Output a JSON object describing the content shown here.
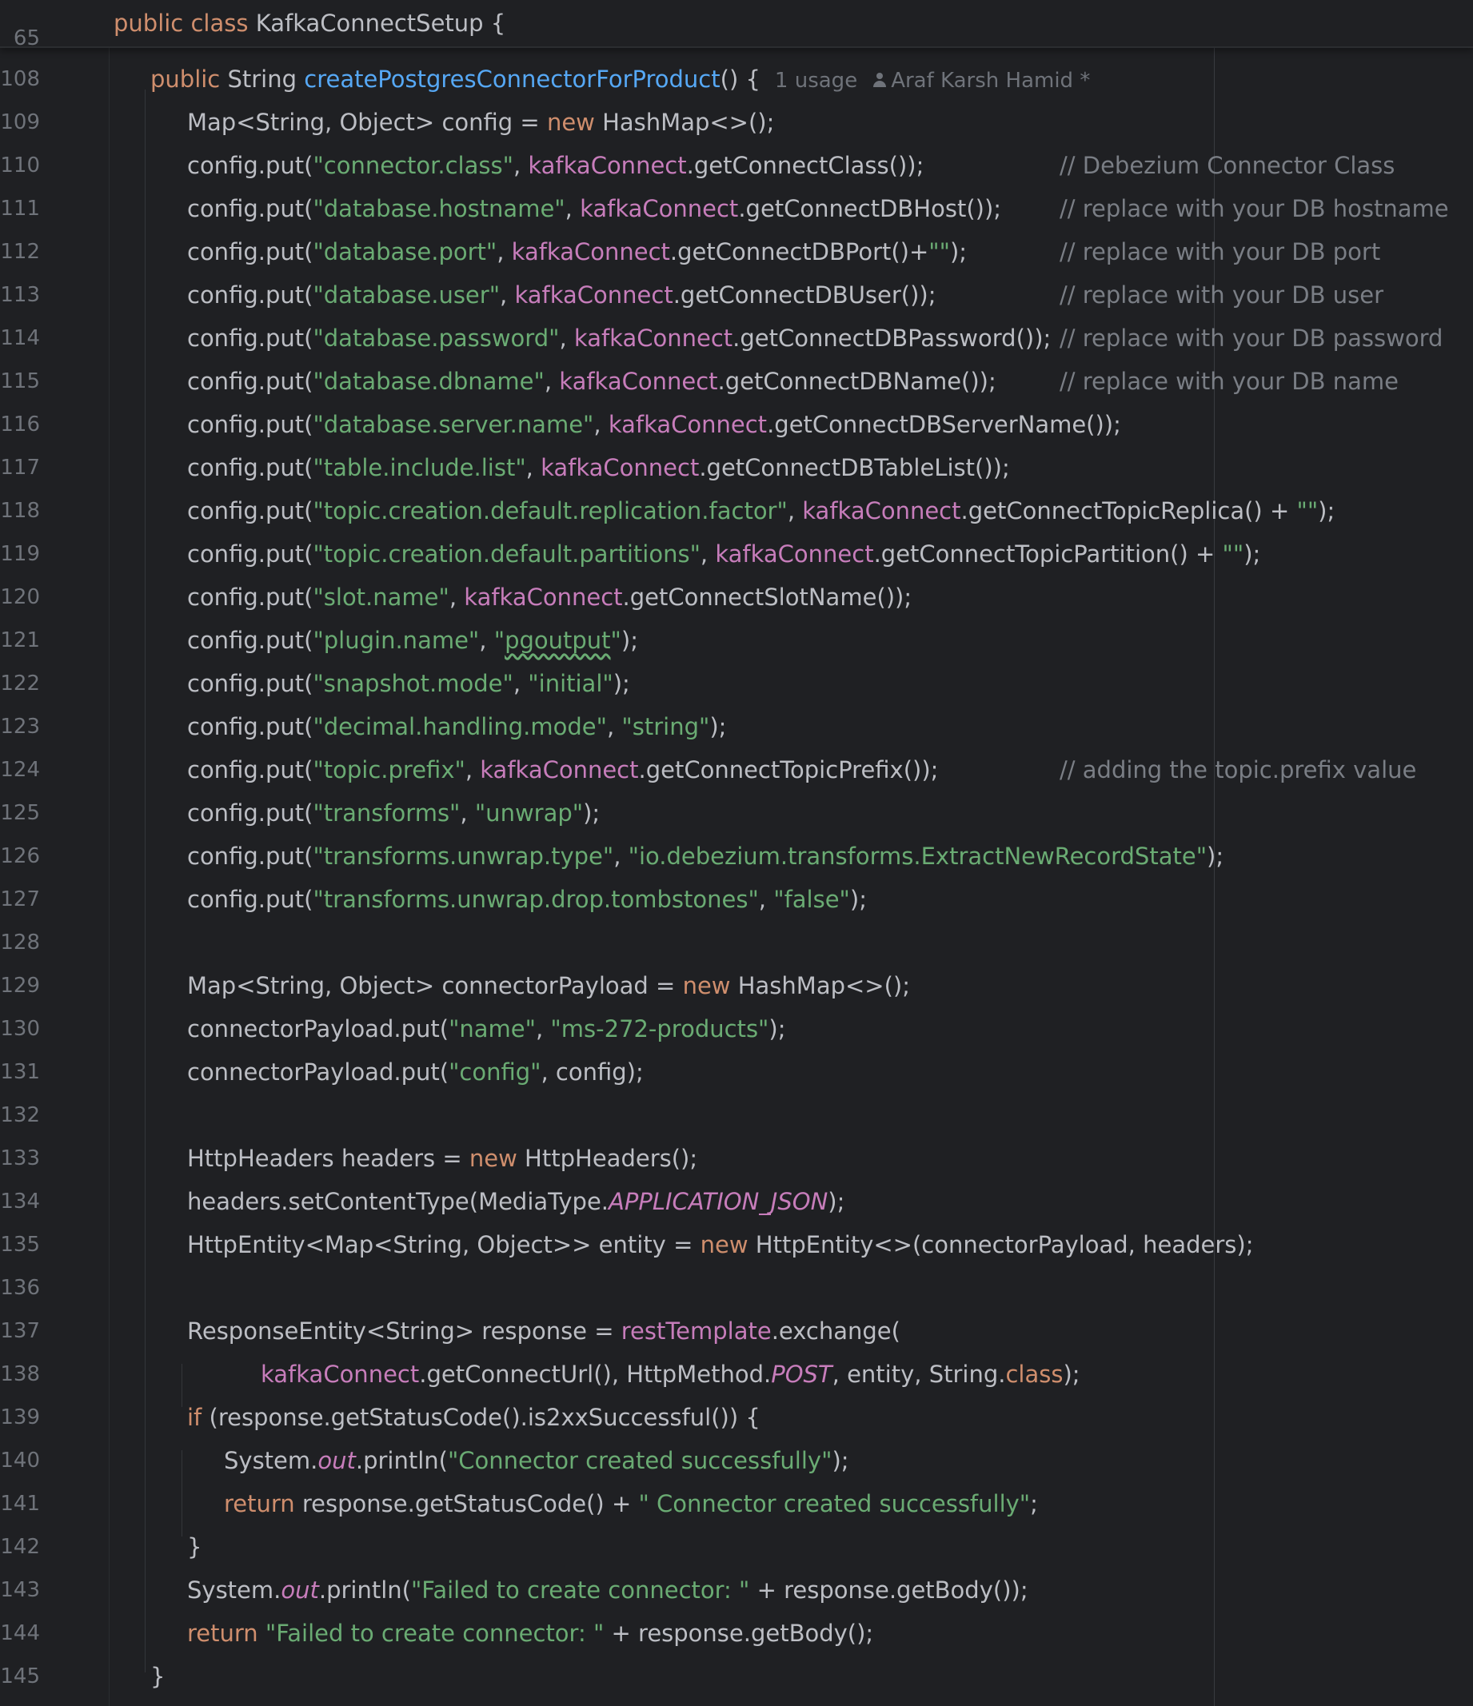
{
  "header": {
    "line_number": "65",
    "kw_public": "public",
    "kw_class": "class",
    "class_name": "KafkaConnectSetup",
    "brace": " {"
  },
  "method": {
    "line_number": "108",
    "kw_public": "public",
    "return_type": "String",
    "name": "createPostgresConnectorForProduct",
    "signature_end": "() {",
    "usage_hint": "1 usage",
    "author_hint": "Araf Karsh Hamid *"
  },
  "lines": [
    {
      "n": "108",
      "indent": 0,
      "tokens": []
    },
    {
      "n": "109",
      "indent": 1,
      "tokens": [
        {
          "t": "Map<String, Object> config = "
        },
        {
          "t": "new",
          "c": "kw"
        },
        {
          "t": " HashMap<>();"
        }
      ]
    },
    {
      "n": "110",
      "indent": 1,
      "tokens": [
        {
          "t": "config.put("
        },
        {
          "t": "\"connector.class\"",
          "c": "str"
        },
        {
          "t": ", "
        },
        {
          "t": "kafkaConnect",
          "c": "fld"
        },
        {
          "t": ".getConnectClass());"
        }
      ],
      "comment": "// Debezium Connector Class"
    },
    {
      "n": "111",
      "indent": 1,
      "tokens": [
        {
          "t": "config.put("
        },
        {
          "t": "\"database.hostname\"",
          "c": "str"
        },
        {
          "t": ", "
        },
        {
          "t": "kafkaConnect",
          "c": "fld"
        },
        {
          "t": ".getConnectDBHost());"
        }
      ],
      "comment": "// replace with your DB hostname"
    },
    {
      "n": "112",
      "indent": 1,
      "tokens": [
        {
          "t": "config.put("
        },
        {
          "t": "\"database.port\"",
          "c": "str"
        },
        {
          "t": ", "
        },
        {
          "t": "kafkaConnect",
          "c": "fld"
        },
        {
          "t": ".getConnectDBPort()+"
        },
        {
          "t": "\"\"",
          "c": "str"
        },
        {
          "t": ");"
        }
      ],
      "comment": "// replace with your DB port"
    },
    {
      "n": "113",
      "indent": 1,
      "tokens": [
        {
          "t": "config.put("
        },
        {
          "t": "\"database.user\"",
          "c": "str"
        },
        {
          "t": ", "
        },
        {
          "t": "kafkaConnect",
          "c": "fld"
        },
        {
          "t": ".getConnectDBUser());"
        }
      ],
      "comment": "// replace with your DB user"
    },
    {
      "n": "114",
      "indent": 1,
      "tokens": [
        {
          "t": "config.put("
        },
        {
          "t": "\"database.password\"",
          "c": "str"
        },
        {
          "t": ", "
        },
        {
          "t": "kafkaConnect",
          "c": "fld"
        },
        {
          "t": ".getConnectDBPassword());"
        }
      ],
      "comment": "// replace with your DB password"
    },
    {
      "n": "115",
      "indent": 1,
      "tokens": [
        {
          "t": "config.put("
        },
        {
          "t": "\"database.dbname\"",
          "c": "str"
        },
        {
          "t": ", "
        },
        {
          "t": "kafkaConnect",
          "c": "fld"
        },
        {
          "t": ".getConnectDBName());"
        }
      ],
      "comment": "// replace with your DB name"
    },
    {
      "n": "116",
      "indent": 1,
      "tokens": [
        {
          "t": "config.put("
        },
        {
          "t": "\"database.server.name\"",
          "c": "str"
        },
        {
          "t": ", "
        },
        {
          "t": "kafkaConnect",
          "c": "fld"
        },
        {
          "t": ".getConnectDBServerName());"
        }
      ]
    },
    {
      "n": "117",
      "indent": 1,
      "tokens": [
        {
          "t": "config.put("
        },
        {
          "t": "\"table.include.list\"",
          "c": "str"
        },
        {
          "t": ", "
        },
        {
          "t": "kafkaConnect",
          "c": "fld"
        },
        {
          "t": ".getConnectDBTableList());"
        }
      ]
    },
    {
      "n": "118",
      "indent": 1,
      "tokens": [
        {
          "t": "config.put("
        },
        {
          "t": "\"topic.creation.default.replication.factor\"",
          "c": "str"
        },
        {
          "t": ", "
        },
        {
          "t": "kafkaConnect",
          "c": "fld"
        },
        {
          "t": ".getConnectTopicReplica() + "
        },
        {
          "t": "\"\"",
          "c": "str"
        },
        {
          "t": ");"
        }
      ]
    },
    {
      "n": "119",
      "indent": 1,
      "tokens": [
        {
          "t": "config.put("
        },
        {
          "t": "\"topic.creation.default.partitions\"",
          "c": "str"
        },
        {
          "t": ", "
        },
        {
          "t": "kafkaConnect",
          "c": "fld"
        },
        {
          "t": ".getConnectTopicPartition() + "
        },
        {
          "t": "\"\"",
          "c": "str"
        },
        {
          "t": ");"
        }
      ]
    },
    {
      "n": "120",
      "indent": 1,
      "tokens": [
        {
          "t": "config.put("
        },
        {
          "t": "\"slot.name\"",
          "c": "str"
        },
        {
          "t": ", "
        },
        {
          "t": "kafkaConnect",
          "c": "fld"
        },
        {
          "t": ".getConnectSlotName());"
        }
      ]
    },
    {
      "n": "121",
      "indent": 1,
      "tokens": [
        {
          "t": "config.put("
        },
        {
          "t": "\"plugin.name\"",
          "c": "str"
        },
        {
          "t": ", "
        },
        {
          "t": "\"",
          "c": "str"
        },
        {
          "t": "pgoutput",
          "c": "str squiggle"
        },
        {
          "t": "\"",
          "c": "str"
        },
        {
          "t": ");"
        }
      ]
    },
    {
      "n": "122",
      "indent": 1,
      "tokens": [
        {
          "t": "config.put("
        },
        {
          "t": "\"snapshot.mode\"",
          "c": "str"
        },
        {
          "t": ", "
        },
        {
          "t": "\"initial\"",
          "c": "str"
        },
        {
          "t": ");"
        }
      ]
    },
    {
      "n": "123",
      "indent": 1,
      "tokens": [
        {
          "t": "config.put("
        },
        {
          "t": "\"decimal.handling.mode\"",
          "c": "str"
        },
        {
          "t": ", "
        },
        {
          "t": "\"string\"",
          "c": "str"
        },
        {
          "t": ");"
        }
      ]
    },
    {
      "n": "124",
      "indent": 1,
      "tokens": [
        {
          "t": "config.put("
        },
        {
          "t": "\"topic.prefix\"",
          "c": "str"
        },
        {
          "t": ", "
        },
        {
          "t": "kafkaConnect",
          "c": "fld"
        },
        {
          "t": ".getConnectTopicPrefix());"
        }
      ],
      "comment": "// adding the topic.prefix value"
    },
    {
      "n": "125",
      "indent": 1,
      "tokens": [
        {
          "t": "config.put("
        },
        {
          "t": "\"transforms\"",
          "c": "str"
        },
        {
          "t": ", "
        },
        {
          "t": "\"unwrap\"",
          "c": "str"
        },
        {
          "t": ");"
        }
      ]
    },
    {
      "n": "126",
      "indent": 1,
      "tokens": [
        {
          "t": "config.put("
        },
        {
          "t": "\"transforms.unwrap.type\"",
          "c": "str"
        },
        {
          "t": ", "
        },
        {
          "t": "\"io.debezium.transforms.ExtractNewRecordState\"",
          "c": "str"
        },
        {
          "t": ");"
        }
      ]
    },
    {
      "n": "127",
      "indent": 1,
      "tokens": [
        {
          "t": "config.put("
        },
        {
          "t": "\"transforms.unwrap.drop.tombstones\"",
          "c": "str"
        },
        {
          "t": ", "
        },
        {
          "t": "\"false\"",
          "c": "str"
        },
        {
          "t": ");"
        }
      ]
    },
    {
      "n": "128",
      "indent": 1,
      "tokens": []
    },
    {
      "n": "129",
      "indent": 1,
      "tokens": [
        {
          "t": "Map<String, Object> connectorPayload = "
        },
        {
          "t": "new",
          "c": "kw"
        },
        {
          "t": " HashMap<>();"
        }
      ]
    },
    {
      "n": "130",
      "indent": 1,
      "tokens": [
        {
          "t": "connectorPayload.put("
        },
        {
          "t": "\"name\"",
          "c": "str"
        },
        {
          "t": ", "
        },
        {
          "t": "\"ms-272-products\"",
          "c": "str"
        },
        {
          "t": ");"
        }
      ]
    },
    {
      "n": "131",
      "indent": 1,
      "tokens": [
        {
          "t": "connectorPayload.put("
        },
        {
          "t": "\"config\"",
          "c": "str"
        },
        {
          "t": ", config);"
        }
      ]
    },
    {
      "n": "132",
      "indent": 1,
      "tokens": []
    },
    {
      "n": "133",
      "indent": 1,
      "tokens": [
        {
          "t": "HttpHeaders headers = "
        },
        {
          "t": "new",
          "c": "kw"
        },
        {
          "t": " HttpHeaders();"
        }
      ]
    },
    {
      "n": "134",
      "indent": 1,
      "tokens": [
        {
          "t": "headers.setContentType(MediaType."
        },
        {
          "t": "APPLICATION_JSON",
          "c": "fld ital"
        },
        {
          "t": ");"
        }
      ]
    },
    {
      "n": "135",
      "indent": 1,
      "tokens": [
        {
          "t": "HttpEntity<Map<String, Object>> entity = "
        },
        {
          "t": "new",
          "c": "kw"
        },
        {
          "t": " HttpEntity<>(connectorPayload, headers);"
        }
      ]
    },
    {
      "n": "136",
      "indent": 1,
      "tokens": []
    },
    {
      "n": "137",
      "indent": 1,
      "tokens": [
        {
          "t": "ResponseEntity<String> response = "
        },
        {
          "t": "restTemplate",
          "c": "fld"
        },
        {
          "t": ".exchange("
        }
      ]
    },
    {
      "n": "138",
      "indent": 3,
      "tokens": [
        {
          "t": "kafkaConnect",
          "c": "fld"
        },
        {
          "t": ".getConnectUrl(), HttpMethod."
        },
        {
          "t": "POST",
          "c": "fld ital"
        },
        {
          "t": ", entity, String."
        },
        {
          "t": "class",
          "c": "kw"
        },
        {
          "t": ");"
        }
      ]
    },
    {
      "n": "139",
      "indent": 1,
      "tokens": [
        {
          "t": "if",
          "c": "kw"
        },
        {
          "t": " (response.getStatusCode().is2xxSuccessful()) {"
        }
      ]
    },
    {
      "n": "140",
      "indent": 2,
      "tokens": [
        {
          "t": "System."
        },
        {
          "t": "out",
          "c": "fld ital"
        },
        {
          "t": ".println("
        },
        {
          "t": "\"Connector created successfully\"",
          "c": "str"
        },
        {
          "t": ");"
        }
      ]
    },
    {
      "n": "141",
      "indent": 2,
      "tokens": [
        {
          "t": "return",
          "c": "kw"
        },
        {
          "t": " response.getStatusCode() + "
        },
        {
          "t": "\" Connector created successfully\"",
          "c": "str"
        },
        {
          "t": ";"
        }
      ]
    },
    {
      "n": "142",
      "indent": 1,
      "tokens": [
        {
          "t": "}"
        }
      ]
    },
    {
      "n": "143",
      "indent": 1,
      "tokens": [
        {
          "t": "System."
        },
        {
          "t": "out",
          "c": "fld ital"
        },
        {
          "t": ".println("
        },
        {
          "t": "\"Failed to create connector: \"",
          "c": "str"
        },
        {
          "t": " + response.getBody());"
        }
      ]
    },
    {
      "n": "144",
      "indent": 1,
      "tokens": [
        {
          "t": "return",
          "c": "kw"
        },
        {
          "t": " "
        },
        {
          "t": "\"Failed to create connector: \"",
          "c": "str"
        },
        {
          "t": " + response.getBody();"
        }
      ]
    },
    {
      "n": "145",
      "indent": 0,
      "tokens": [
        {
          "t": "}"
        }
      ]
    }
  ],
  "colors": {
    "background": "#1f2023",
    "text": "#bcbec4",
    "keyword": "#cf8e6d",
    "function": "#56a8f5",
    "string": "#6aab73",
    "field": "#c77dbb",
    "comment": "#7a7e85",
    "line_number": "#6f737a"
  },
  "icons": {
    "author": "person-icon"
  }
}
